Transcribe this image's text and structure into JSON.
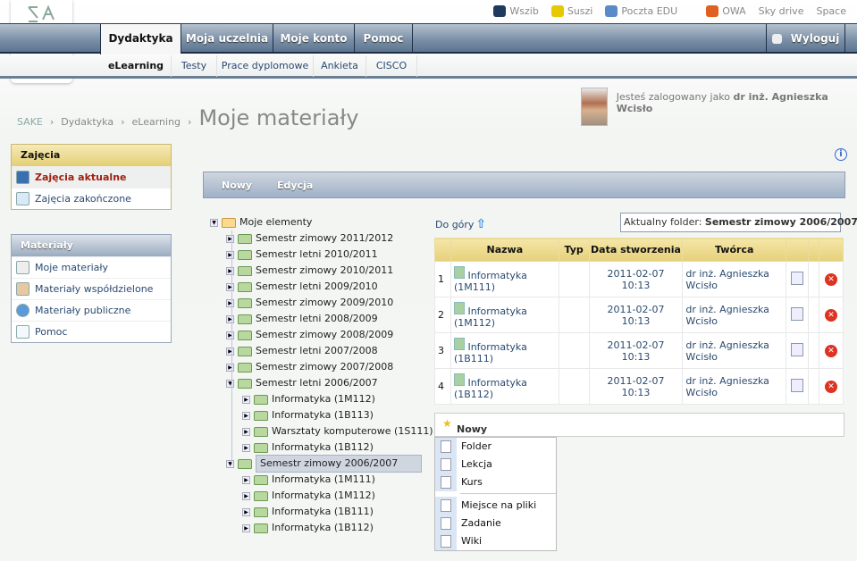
{
  "toplinks": [
    {
      "label": "Wszib",
      "icon": "graduation-cap-icon",
      "color": "#1e3a60"
    },
    {
      "label": "Suszi",
      "icon": "spiral-icon",
      "color": "#e8c800"
    },
    {
      "label": "Poczta EDU",
      "icon": "mail-cap-icon",
      "color": "#5a8ac8"
    },
    {
      "label": "OWA",
      "icon": "owa-icon",
      "color": "#e06020"
    },
    {
      "label": "Sky drive"
    },
    {
      "label": "Space"
    }
  ],
  "nav": {
    "tabs": [
      "Dydaktyka",
      "Moja uczelnia",
      "Moje konto",
      "Pomoc"
    ],
    "logout": "Wyloguj"
  },
  "subnav": [
    "eLearning",
    "Testy",
    "Prace dyplomowe",
    "Ankieta",
    "CISCO"
  ],
  "breadcrumb": [
    "SAKE",
    "Dydaktyka",
    "eLearning"
  ],
  "page_title": "Moje materiały",
  "user": {
    "prefix": "Jesteś zalogowany jako",
    "name": "dr inż. Agnieszka Wcisło"
  },
  "sidebar": {
    "zajecia": {
      "title": "Zajęcia",
      "items": [
        "Zajęcia aktualne",
        "Zajęcia zakończone"
      ]
    },
    "materialy": {
      "title": "Materiały",
      "items": [
        "Moje materiały",
        "Materiały współdzielone",
        "Materiały publiczne",
        "Pomoc"
      ]
    }
  },
  "toolbar": [
    "Nowy",
    "Edycja"
  ],
  "tree": [
    {
      "label": "Moje elementy",
      "level": 0,
      "expanded": true
    },
    {
      "label": "Semestr zimowy 2011/2012",
      "level": 1
    },
    {
      "label": "Semestr letni 2010/2011",
      "level": 1
    },
    {
      "label": "Semestr zimowy 2010/2011",
      "level": 1
    },
    {
      "label": "Semestr letni 2009/2010",
      "level": 1
    },
    {
      "label": "Semestr zimowy 2009/2010",
      "level": 1
    },
    {
      "label": "Semestr letni 2008/2009",
      "level": 1
    },
    {
      "label": "Semestr zimowy 2008/2009",
      "level": 1
    },
    {
      "label": "Semestr letni 2007/2008",
      "level": 1
    },
    {
      "label": "Semestr zimowy 2007/2008",
      "level": 1
    },
    {
      "label": "Semestr letni 2006/2007",
      "level": 1,
      "expanded": true
    },
    {
      "label": "Informatyka (1M112)",
      "level": 2
    },
    {
      "label": "Informatyka (1B113)",
      "level": 2
    },
    {
      "label": "Warsztaty komputerowe (1S111)",
      "level": 2
    },
    {
      "label": "Informatyka (1B112)",
      "level": 2
    },
    {
      "label": "Semestr zimowy 2006/2007",
      "level": 1,
      "expanded": true,
      "selected": true
    },
    {
      "label": "Informatyka (1M111)",
      "level": 2
    },
    {
      "label": "Informatyka (1M112)",
      "level": 2
    },
    {
      "label": "Informatyka (1B111)",
      "level": 2
    },
    {
      "label": "Informatyka (1B112)",
      "level": 2
    }
  ],
  "up_link": "Do góry",
  "current_folder": {
    "label": "Aktualny folder:",
    "value": "Semestr zimowy 2006/2007"
  },
  "table": {
    "headers": [
      "",
      "Nazwa",
      "Typ",
      "Data stworzenia",
      "Twórca",
      "",
      "",
      ""
    ],
    "rows": [
      {
        "n": "1",
        "name": "Informatyka",
        "code": "(1M111)",
        "typ": "",
        "date": "2011-02-07 10:13",
        "creator": "dr inż. Agnieszka Wcisło"
      },
      {
        "n": "2",
        "name": "Informatyka",
        "code": "(1M112)",
        "typ": "",
        "date": "2011-02-07 10:13",
        "creator": "dr inż. Agnieszka Wcisło"
      },
      {
        "n": "3",
        "name": "Informatyka",
        "code": "(1B111)",
        "typ": "",
        "date": "2011-02-07 10:13",
        "creator": "dr inż. Agnieszka Wcisło"
      },
      {
        "n": "4",
        "name": "Informatyka",
        "code": "(1B112)",
        "typ": "",
        "date": "2011-02-07 10:13",
        "creator": "dr inż. Agnieszka Wcisło"
      }
    ]
  },
  "new_menu": {
    "title": "Nowy",
    "items": [
      [
        "Folder",
        "Lekcja",
        "Kurs"
      ],
      [
        "Miejsce na pliki",
        "Zadanie",
        "Wiki"
      ]
    ]
  }
}
